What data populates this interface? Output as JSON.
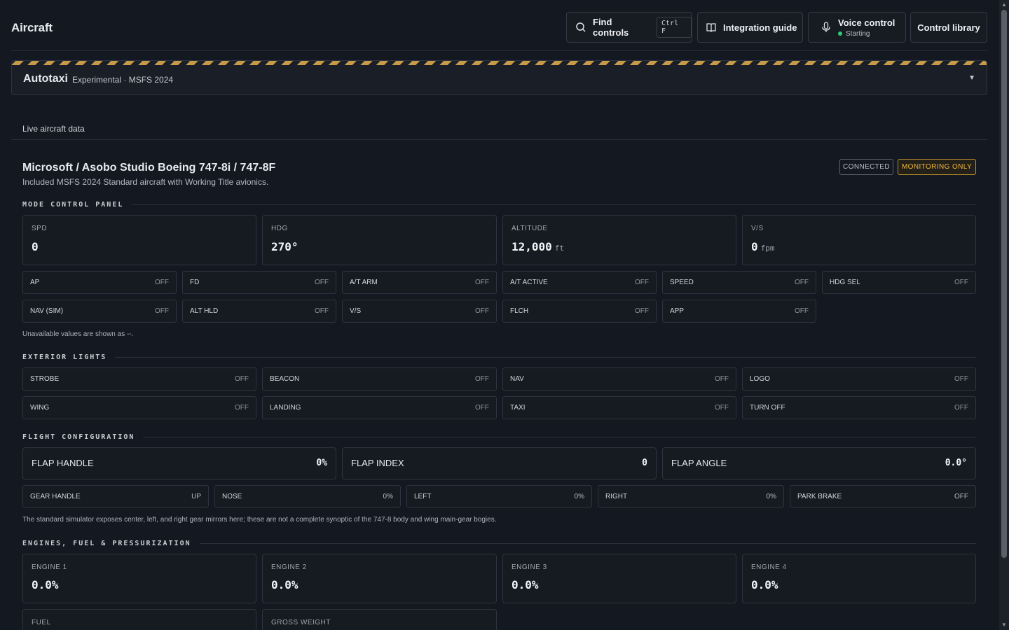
{
  "header": {
    "title": "Aircraft",
    "find": {
      "label": "Find controls",
      "shortcut": "Ctrl F",
      "icon": "search-icon"
    },
    "guide": {
      "label": "Integration guide",
      "icon": "book-icon"
    },
    "voice": {
      "label": "Voice control",
      "status": "Starting",
      "status_color": "#2ecc71",
      "icon": "microphone-icon"
    },
    "library": {
      "label": "Control library"
    }
  },
  "autotaxi": {
    "title": "Autotaxi",
    "subtitle": "Experimental · MSFS 2024",
    "caret": "▼"
  },
  "live_label": "Live aircraft data",
  "aircraft": {
    "name": "Microsoft / Asobo Studio Boeing 747-8i / 747-8F",
    "description": "Included MSFS 2024 Standard aircraft with Working Title avionics.",
    "badges": {
      "connected": "CONNECTED",
      "monitoring": "MONITORING ONLY"
    }
  },
  "mcp": {
    "heading": "MODE CONTROL PANEL",
    "readouts": [
      {
        "label": "SPD",
        "value": "0",
        "unit": ""
      },
      {
        "label": "HDG",
        "value": "270°",
        "unit": ""
      },
      {
        "label": "ALTITUDE",
        "value": "12,000",
        "unit": "ft"
      },
      {
        "label": "V/S",
        "value": "0",
        "unit": "fpm"
      }
    ],
    "modes": [
      {
        "label": "AP",
        "state": "OFF"
      },
      {
        "label": "FD",
        "state": "OFF"
      },
      {
        "label": "A/T ARM",
        "state": "OFF"
      },
      {
        "label": "A/T ACTIVE",
        "state": "OFF"
      },
      {
        "label": "SPEED",
        "state": "OFF"
      },
      {
        "label": "HDG SEL",
        "state": "OFF"
      },
      {
        "label": "NAV (SIM)",
        "state": "OFF"
      },
      {
        "label": "ALT HLD",
        "state": "OFF"
      },
      {
        "label": "V/S",
        "state": "OFF"
      },
      {
        "label": "FLCH",
        "state": "OFF"
      },
      {
        "label": "APP",
        "state": "OFF"
      }
    ],
    "note": "Unavailable values are shown as --."
  },
  "lights": {
    "heading": "EXTERIOR LIGHTS",
    "items": [
      {
        "label": "STROBE",
        "state": "OFF"
      },
      {
        "label": "BEACON",
        "state": "OFF"
      },
      {
        "label": "NAV",
        "state": "OFF"
      },
      {
        "label": "LOGO",
        "state": "OFF"
      },
      {
        "label": "WING",
        "state": "OFF"
      },
      {
        "label": "LANDING",
        "state": "OFF"
      },
      {
        "label": "TAXI",
        "state": "OFF"
      },
      {
        "label": "TURN OFF",
        "state": "OFF"
      }
    ]
  },
  "config": {
    "heading": "FLIGHT CONFIGURATION",
    "flaps": [
      {
        "label": "FLAP HANDLE",
        "value": "0%"
      },
      {
        "label": "FLAP INDEX",
        "value": "0"
      },
      {
        "label": "FLAP ANGLE",
        "value": "0.0°"
      }
    ],
    "gear": [
      {
        "label": "GEAR HANDLE",
        "value": "UP"
      },
      {
        "label": "NOSE",
        "value": "0%"
      },
      {
        "label": "LEFT",
        "value": "0%"
      },
      {
        "label": "RIGHT",
        "value": "0%"
      },
      {
        "label": "PARK BRAKE",
        "value": "OFF"
      }
    ],
    "note": "The standard simulator exposes center, left, and right gear mirrors here; these are not a complete synoptic of the 747-8 body and wing main-gear bogies."
  },
  "engines": {
    "heading": "ENGINES, FUEL & PRESSURIZATION",
    "items": [
      {
        "label": "ENGINE 1",
        "value": "0.0%"
      },
      {
        "label": "ENGINE 2",
        "value": "0.0%"
      },
      {
        "label": "ENGINE 3",
        "value": "0.0%"
      },
      {
        "label": "ENGINE 4",
        "value": "0.0%"
      }
    ],
    "more": [
      {
        "label": "FUEL"
      },
      {
        "label": "GROSS WEIGHT"
      }
    ]
  },
  "colors": {
    "background": "#141820",
    "warning_accent": "#f0b73a",
    "stripe": "#c79a4a"
  }
}
